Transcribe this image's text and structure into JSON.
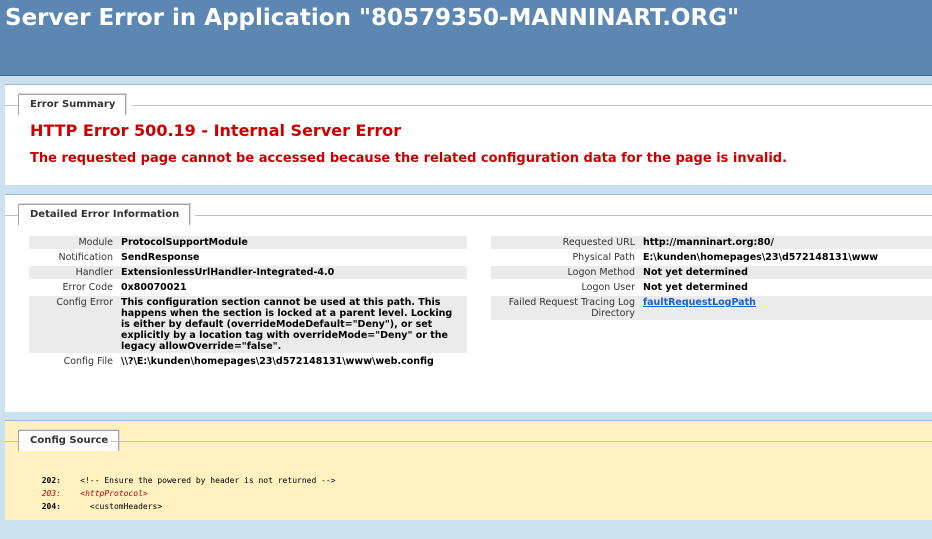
{
  "header": {
    "title": "Server Error in Application \"80579350-MANNINART.ORG\""
  },
  "summary": {
    "tab_label": "Error Summary",
    "error_title": "HTTP Error 500.19 - Internal Server Error",
    "error_description": "The requested page cannot be accessed because the related configuration data for the page is invalid."
  },
  "detailed": {
    "tab_label": "Detailed Error Information",
    "left": [
      {
        "label": "Module",
        "value": "ProtocolSupportModule"
      },
      {
        "label": "Notification",
        "value": "SendResponse"
      },
      {
        "label": "Handler",
        "value": "ExtensionlessUrlHandler-Integrated-4.0"
      },
      {
        "label": "Error Code",
        "value": "0x80070021"
      },
      {
        "label": "Config Error",
        "value": "This configuration section cannot be used at this path. This happens when the section is locked at a parent level. Locking is either by default (overrideModeDefault=\"Deny\"), or set explicitly by a location tag with overrideMode=\"Deny\" or the legacy allowOverride=\"false\"."
      },
      {
        "label": "Config File",
        "value": "\\\\?\\E:\\kunden\\homepages\\23\\d572148131\\www\\web.config"
      }
    ],
    "right": [
      {
        "label": "Requested URL",
        "value": "http://manninart.org:80/"
      },
      {
        "label": "Physical Path",
        "value": "E:\\kunden\\homepages\\23\\d572148131\\www"
      },
      {
        "label": "Logon Method",
        "value": "Not yet determined"
      },
      {
        "label": "Logon User",
        "value": "Not yet determined"
      },
      {
        "label": "Failed Request Tracing Log Directory",
        "value": "faultRequestLogPath"
      }
    ]
  },
  "config_source": {
    "tab_label": "Config Source",
    "lines": [
      {
        "num": "202:",
        "text": "    <!-- Ensure the powered by header is not returned -->"
      },
      {
        "num": "203:",
        "text": "    <httpProtocol>"
      },
      {
        "num": "204:",
        "text": "      <customHeaders>"
      }
    ]
  }
}
